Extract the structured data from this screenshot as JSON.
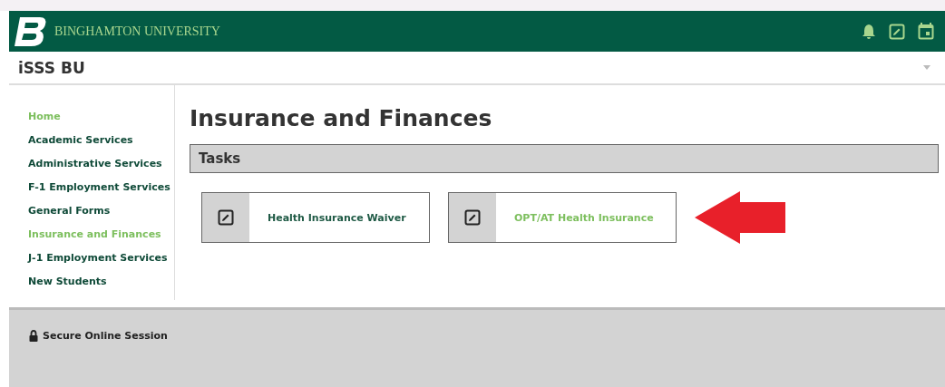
{
  "header": {
    "university": "BINGHAMTON UNIVERSITY"
  },
  "site_title": "iSSS BU",
  "sidebar": {
    "items": [
      {
        "label": "Home",
        "highlighted": true
      },
      {
        "label": "Academic Services",
        "highlighted": false
      },
      {
        "label": "Administrative Services",
        "highlighted": false
      },
      {
        "label": "F-1 Employment Services",
        "highlighted": false
      },
      {
        "label": "General Forms",
        "highlighted": false
      },
      {
        "label": "Insurance and Finances",
        "highlighted": true
      },
      {
        "label": "J-1 Employment Services",
        "highlighted": false
      },
      {
        "label": "New Students",
        "highlighted": false
      }
    ]
  },
  "page_title": "Insurance and Finances",
  "section_title": "Tasks",
  "tasks": [
    {
      "label": "Health Insurance Waiver",
      "highlighted": false
    },
    {
      "label": "OPT/AT Health Insurance",
      "highlighted": true
    }
  ],
  "footer": {
    "text": "Secure Online Session"
  }
}
